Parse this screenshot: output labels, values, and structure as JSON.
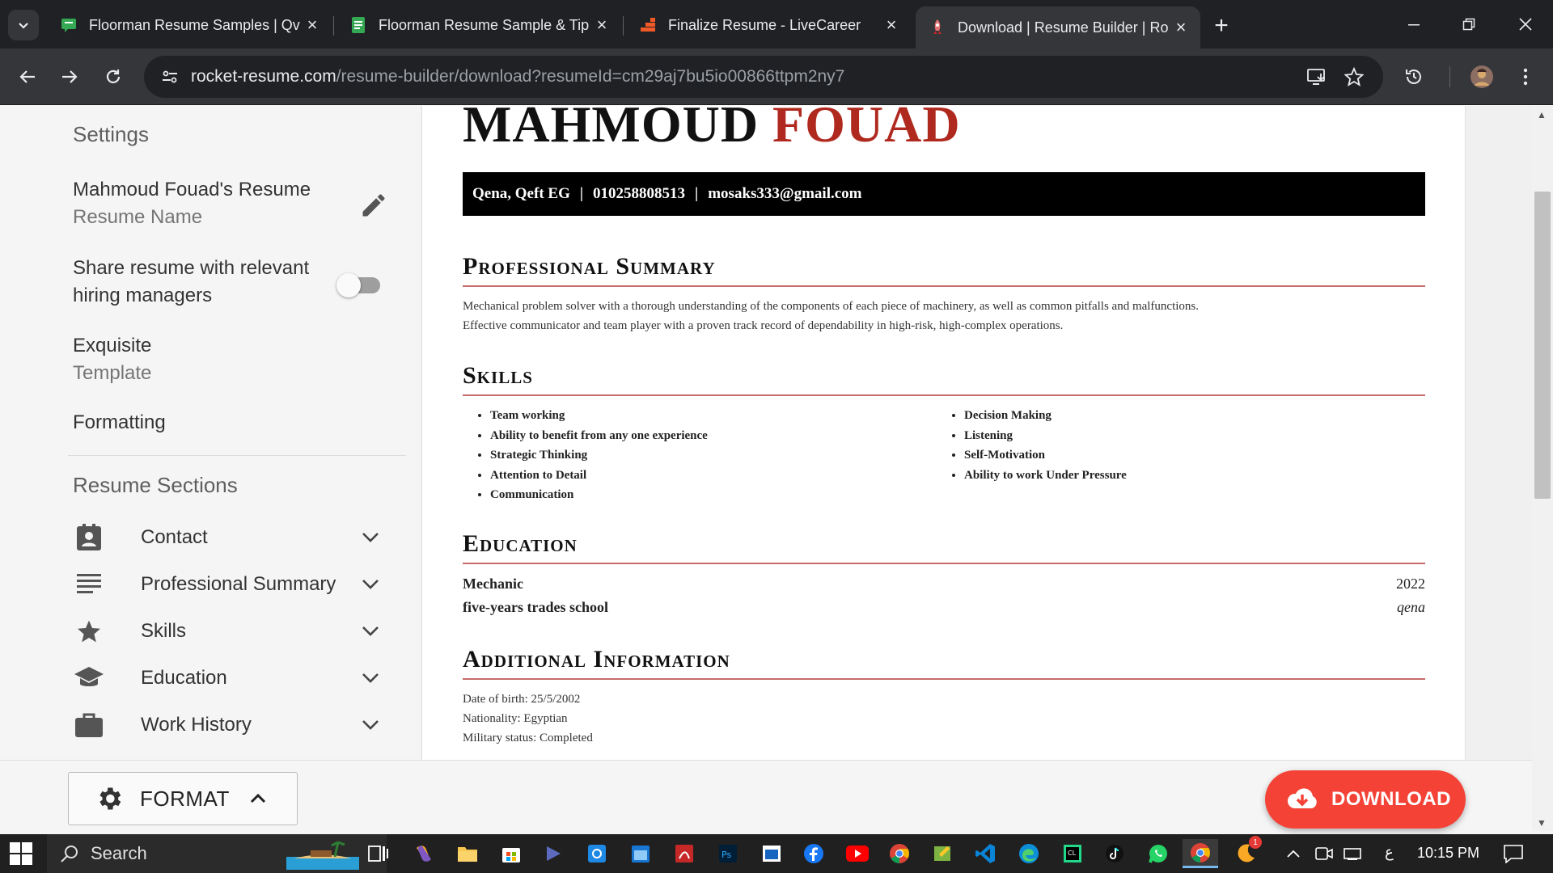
{
  "browser": {
    "tabs": [
      {
        "title": "Floorman Resume Samples | Qv",
        "icon": "green-chat-icon"
      },
      {
        "title": "Floorman Resume Sample & Tip",
        "icon": "green-document-icon"
      },
      {
        "title": "Finalize Resume - LiveCareer",
        "icon": "livecareer-grid-icon"
      },
      {
        "title": "Download | Resume Builder | Ro",
        "icon": "rocket-icon",
        "active": true
      }
    ],
    "url_domain": "rocket-resume.com",
    "url_path": "/resume-builder/download?resumeId=cm29aj7bu5io00866ttpm2ny7"
  },
  "sidebar": {
    "settings_heading": "Settings",
    "resume_name_value": "Mahmoud Fouad's Resume",
    "resume_name_label": "Resume Name",
    "share_line1": "Share resume with relevant",
    "share_line2": "hiring managers",
    "share_enabled": false,
    "template_value": "Exquisite",
    "template_label": "Template",
    "formatting_label": "Formatting",
    "sections_heading": "Resume Sections",
    "sections": [
      {
        "label": "Contact",
        "icon": "contact-card-icon"
      },
      {
        "label": "Professional Summary",
        "icon": "lines-icon"
      },
      {
        "label": "Skills",
        "icon": "star-icon"
      },
      {
        "label": "Education",
        "icon": "graduation-cap-icon"
      },
      {
        "label": "Work History",
        "icon": "briefcase-icon"
      }
    ]
  },
  "resume": {
    "first_name": "MAHMOUD",
    "last_name": "FOUAD",
    "location": "Qena, Qeft EG",
    "phone": "010258808513",
    "email": "mosaks333@gmail.com",
    "separator": "|",
    "summary_title": "Professional Summary",
    "summary_line1": "Mechanical problem solver with a thorough understanding of the components of each piece of machinery, as well as common pitfalls and malfunctions.",
    "summary_line2": "Effective communicator and team player with a proven track record of dependability in high-risk, high-complex operations.",
    "skills_title": "Skills",
    "skills_left": [
      "Team working",
      "Ability to benefit from any one experience",
      "Strategic Thinking",
      "Attention to Detail",
      "Communication"
    ],
    "skills_right": [
      "Decision Making",
      "Listening",
      "Self-Motivation",
      "Ability to work Under Pressure"
    ],
    "education_title": "Education",
    "edu_degree": "Mechanic",
    "edu_year": "2022",
    "edu_school": "five-years trades school",
    "edu_city": "qena",
    "additional_title": "Additional Information",
    "additional_lines": [
      "Date of birth: 25/5/2002",
      "Nationality: Egyptian",
      "Military status: Completed"
    ]
  },
  "bottom": {
    "format_label": "FORMAT",
    "download_label": "DOWNLOAD",
    "download_color": "#f44336"
  },
  "taskbar": {
    "search_label": "Search",
    "time": "10:15 PM",
    "lang": "ع",
    "notification_badge": "1"
  }
}
